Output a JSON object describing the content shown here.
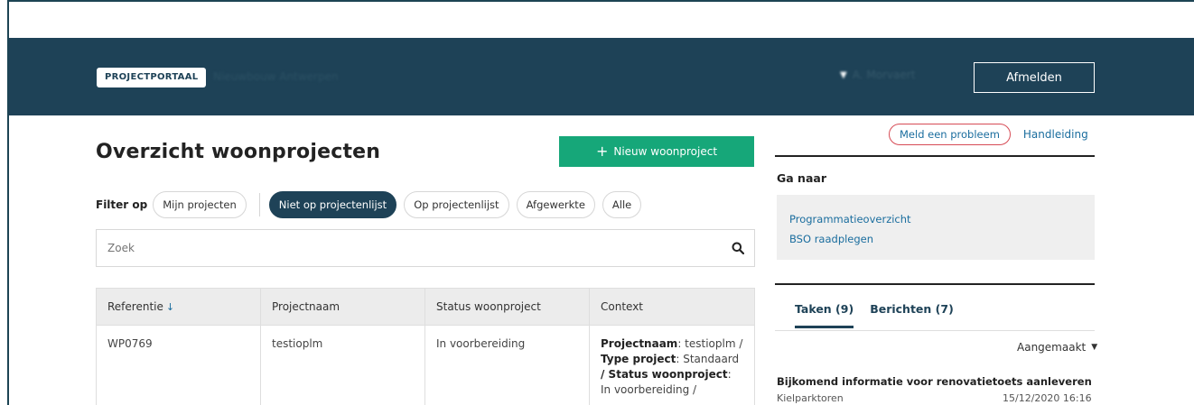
{
  "header": {
    "badge": "PROJECTPORTAAL",
    "subtitle": "Nieuwbouw Antwerpen",
    "user_name": "A. Morvaert",
    "logout_label": "Afmelden"
  },
  "main": {
    "title": "Overzicht woonprojecten",
    "new_button": "Nieuw woonproject",
    "filter_label": "Filter op",
    "filters": [
      "Mijn projecten",
      "Niet op projectenlijst",
      "Op projectenlijst",
      "Afgewerkte",
      "Alle"
    ],
    "active_filter": "Niet op projectenlijst",
    "search_placeholder": "Zoek",
    "table": {
      "headers": [
        "Referentie",
        "Projectnaam",
        "Status woonproject",
        "Context"
      ],
      "sort_indicator": "↓",
      "rows": [
        {
          "referentie": "WP0769",
          "projectnaam": "testioplm",
          "status": "In voorbereiding",
          "context": {
            "label_projectnaam": "Projectnaam",
            "value_projectnaam": ": testioplm /",
            "label_type": "Type project",
            "value_type": ": Standaard",
            "label_status": "/ Status woonproject",
            "value_status": ": In voorbereiding /"
          }
        }
      ]
    }
  },
  "sidebar": {
    "report_problem": "Meld een probleem",
    "manual": "Handleiding",
    "goto_title": "Ga naar",
    "goto_links": [
      "Programmatieoverzicht",
      "BSO raadplegen"
    ],
    "tabs": [
      "Taken (9)",
      "Berichten (7)"
    ],
    "sort_label": "Aangemaakt",
    "task": {
      "title": "Bijkomend informatie voor renovatietoets aanleveren",
      "location": "Kielparktoren",
      "date": "15/12/2020 16:16"
    }
  },
  "colors": {
    "header_bg": "#1e4257",
    "primary_green": "#16a779",
    "link_blue": "#1a6d9e",
    "highlight_red": "#d64b55"
  }
}
